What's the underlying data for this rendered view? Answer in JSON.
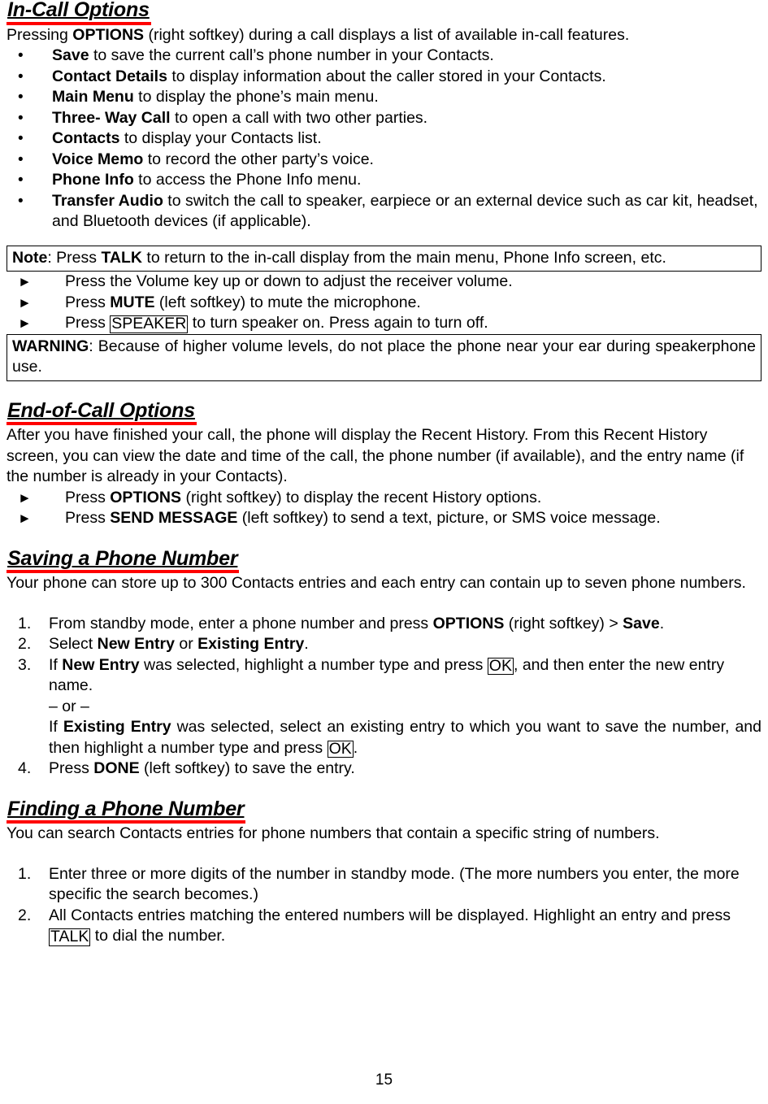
{
  "page": {
    "number": "15",
    "accent_color": "#ff0000",
    "text_color": "#000000",
    "background_color": "#ffffff"
  },
  "sections": {
    "in_call": {
      "heading": "In-Call Options",
      "intro_a": "Pressing ",
      "intro_b": "OPTIONS",
      "intro_c": " (right softkey) during a call displays a list of available in-call features.",
      "bullets": [
        {
          "bullet": "•",
          "term": "Save",
          "rest": " to save the current call’s phone number in your Contacts."
        },
        {
          "bullet": "•",
          "term": "Contact Details",
          "rest": " to display information about the caller stored in your Contacts."
        },
        {
          "bullet": "•",
          "term": "Main Menu",
          "rest": " to display the phone’s main menu."
        },
        {
          "bullet": "•",
          "term": "Three- Way Call",
          "rest": " to open a call with two other parties."
        },
        {
          "bullet": "•",
          "term": "Contacts",
          "rest": " to display your Contacts list."
        },
        {
          "bullet": "•",
          "term": "Voice Memo",
          "rest": " to record the other party’s voice."
        },
        {
          "bullet": "•",
          "term": "Phone Info",
          "rest": " to access the Phone Info menu."
        },
        {
          "bullet": "•",
          "term": "Transfer Audio",
          "rest": " to switch the call to speaker, earpiece or an external device such as car kit, headset, and Bluetooth devices (if applicable)."
        }
      ]
    },
    "note_box": {
      "label": "Note",
      "a": ": Press ",
      "key": "TALK",
      "b": " to return to the in-call display from the main menu, Phone Info screen, etc."
    },
    "key_actions": [
      {
        "arrow": "►",
        "a": "Press the Volume key up or down to adjust the receiver volume.",
        "bold": "",
        "b": "",
        "boxed": "",
        "c": ""
      },
      {
        "arrow": "►",
        "a": "Press ",
        "bold": "MUTE",
        "b": " (left softkey) to mute the microphone.",
        "boxed": "",
        "c": ""
      },
      {
        "arrow": "►",
        "a": "Press ",
        "bold": "",
        "b": "",
        "boxed": "SPEAKER",
        "c": " to turn speaker on. Press again to turn off."
      }
    ],
    "warning_box": {
      "label": "WARNING",
      "text": ": Because of higher volume levels, do not place the phone near your ear during speakerphone use."
    },
    "end_of_call": {
      "heading": "End-of-Call Options",
      "para": "After you have finished your call, the phone will display the Recent History. From this Recent History screen, you can view the date and time of the call, the phone number (if available), and the entry name (if the number is already in your Contacts).",
      "steps": [
        {
          "arrow": "►",
          "a": "Press ",
          "bold": "OPTIONS",
          "b": " (right softkey) to display the recent History options."
        },
        {
          "arrow": "►",
          "a": "Press ",
          "bold": "SEND MESSAGE",
          "b": " (left softkey) to send a text, picture, or SMS voice message."
        }
      ]
    },
    "saving": {
      "heading": "Saving a Phone Number",
      "para": "Your phone can store up to 300 Contacts entries and each entry can contain up to seven phone numbers.",
      "steps": [
        {
          "num": "1.",
          "p1": "From standby mode, enter a phone number and press ",
          "b1": "OPTIONS",
          "p2": " (right softkey) > ",
          "b2": "Save",
          "p3": "."
        },
        {
          "num": "2.",
          "p1": "Select ",
          "b1": "New Entry",
          "p2": " or ",
          "b2": "Existing Entry",
          "p3": "."
        },
        {
          "num": "3.",
          "p1": "If ",
          "b1": "New Entry",
          "p2": " was selected, highlight a number type and press ",
          "boxed1": "OK",
          "p3": ", and then enter the new entry name.",
          "or_text": "– or –",
          "p4": "If ",
          "b2": "Existing Entry",
          "p5": " was selected, select an existing entry to which you want to save the number, and then highlight a number type and press ",
          "boxed2": "OK",
          "p6": "."
        },
        {
          "num": "4.",
          "p1": "Press ",
          "b1": "DONE",
          "p2": " (left softkey) to save the entry."
        }
      ]
    },
    "finding": {
      "heading": "Finding a Phone Number",
      "para": "You can search Contacts entries for phone numbers that contain a specific string of numbers.",
      "steps": [
        {
          "num": "1.",
          "p1": "Enter three or more digits of the number in standby mode. (The more numbers you enter, the more specific the search becomes.)"
        },
        {
          "num": "2.",
          "p1": "All Contacts entries matching the entered numbers will be displayed. Highlight an entry and press ",
          "boxed1": "TALK",
          "p2": " to dial the number."
        }
      ]
    }
  }
}
